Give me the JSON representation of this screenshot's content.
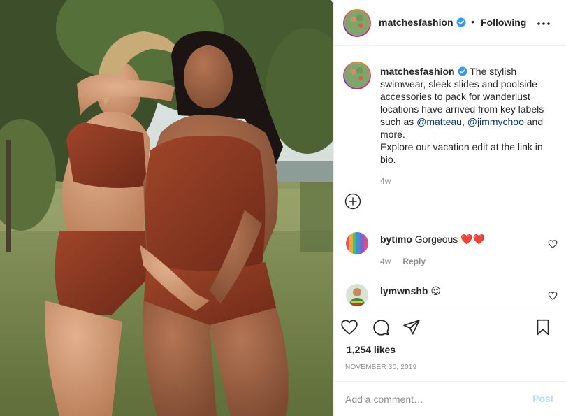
{
  "post": {
    "image_alt": "matchesfashion photo",
    "image_icon": "photo"
  },
  "header": {
    "username": "matchesfashion",
    "separator": "•",
    "follow_state": "Following",
    "more_icon": "more-horizontal-icon",
    "verified_icon": "verified-badge-icon"
  },
  "caption": {
    "username": "matchesfashion",
    "text_1": "The stylish swimwear, sleek slides and poolside accessories to pack for wanderlust locations have arrived from key labels such as ",
    "mention_1": "@matteau",
    "sep": ", ",
    "mention_2": "@jimmychoo",
    "text_2": " and more.",
    "text_3": "Explore our vacation edit at the link in bio.",
    "time": "4w"
  },
  "load_more_icon": "plus-circle-icon",
  "comments": [
    {
      "username": "bytimo",
      "text": "Gorgeous ❤️❤️",
      "time": "4w",
      "reply_label": "Reply"
    },
    {
      "username": "lymwnshb",
      "text": "😍"
    }
  ],
  "actions": {
    "like_icon": "heart-icon",
    "comment_icon": "comment-icon",
    "share_icon": "paper-plane-icon",
    "save_icon": "bookmark-icon"
  },
  "likes": "1,254 likes",
  "date": "NOVEMBER 30, 2019",
  "add_comment": {
    "placeholder": "Add a comment…",
    "post_label": "Post"
  },
  "colors": {
    "accent_link": "#00376b",
    "verified_blue": "#3897f0",
    "post_disabled": "#b3dbff",
    "muted": "#8e8e8e",
    "swimsuit": "#8e3a20"
  }
}
